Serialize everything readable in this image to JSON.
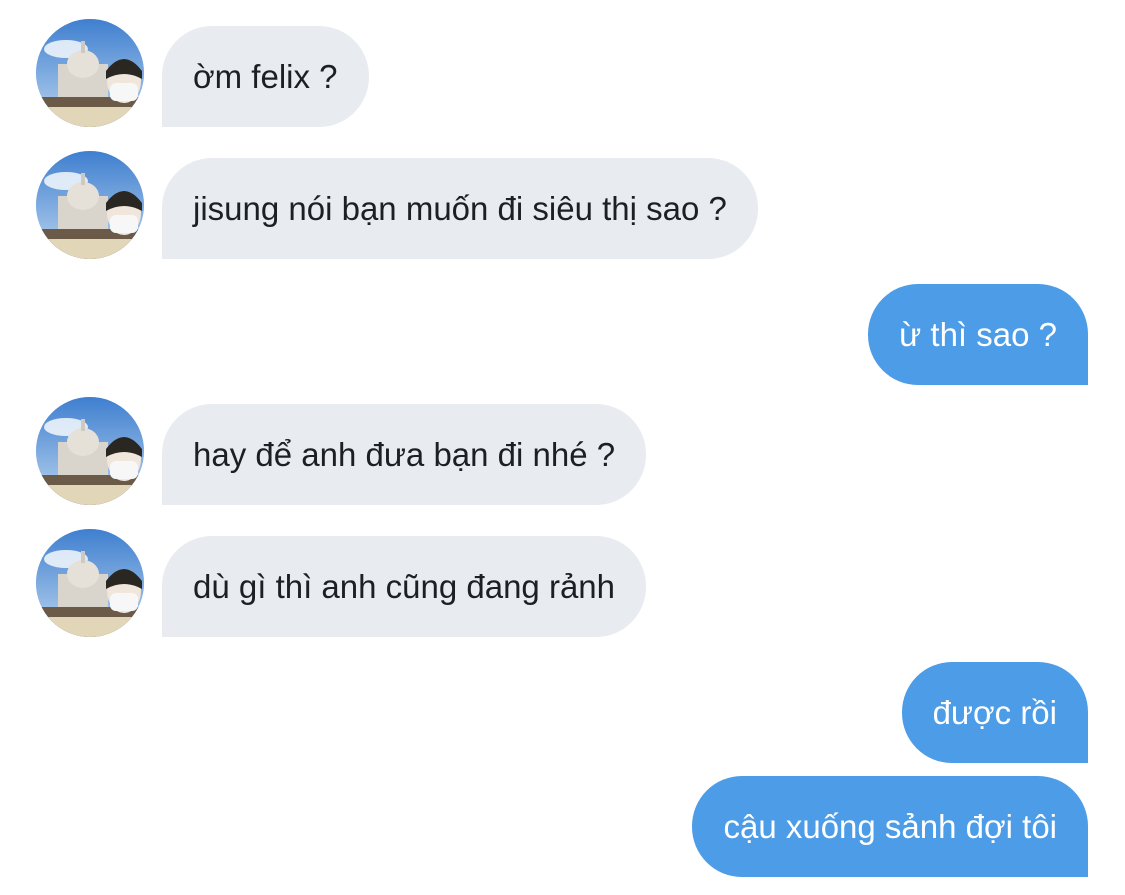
{
  "conversation": {
    "messages": [
      {
        "direction": "incoming",
        "text": "ờm felix ?"
      },
      {
        "direction": "incoming",
        "text": "jisung nói bạn muốn đi siêu thị sao ?"
      },
      {
        "direction": "outgoing",
        "text": "ừ thì sao ?"
      },
      {
        "direction": "incoming",
        "text": "hay để anh đưa bạn đi nhé ?"
      },
      {
        "direction": "incoming",
        "text": "dù gì thì anh cũng đang rảnh"
      },
      {
        "direction": "outgoing",
        "text": "được rồi"
      },
      {
        "direction": "outgoing",
        "text": "cậu xuống sảnh đợi tôi"
      }
    ]
  },
  "colors": {
    "incoming_bubble": "#e8ebef",
    "incoming_text": "#1c2026",
    "outgoing_bubble": "#4c9ce8",
    "outgoing_text": "#ffffff",
    "background": "#ffffff"
  },
  "icons": {
    "avatar": "contact-avatar-photo"
  }
}
